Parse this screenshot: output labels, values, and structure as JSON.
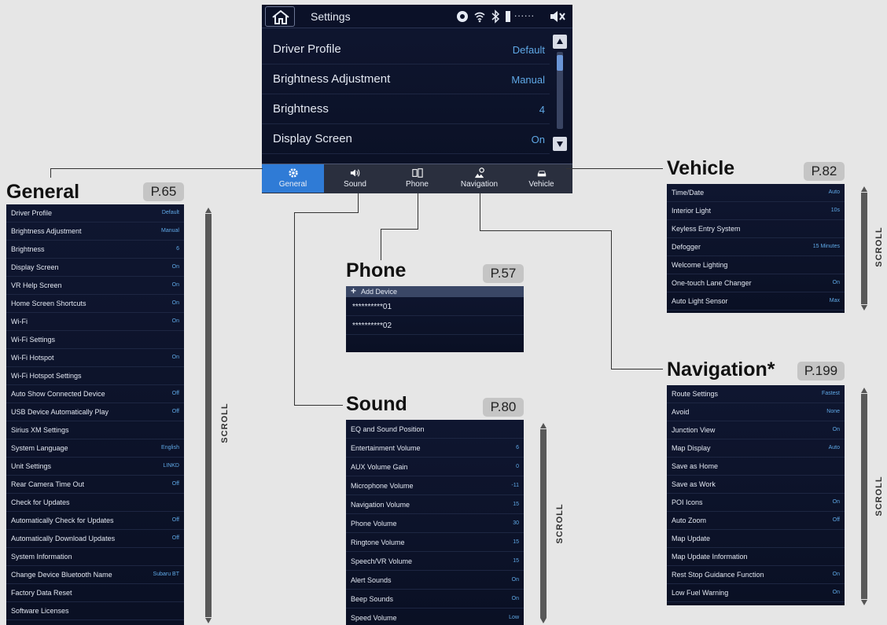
{
  "main_screen": {
    "title": "Settings",
    "battery": "......",
    "rows": [
      {
        "label": "Driver Profile",
        "value": "Default"
      },
      {
        "label": "Brightness Adjustment",
        "value": "Manual"
      },
      {
        "label": "Brightness",
        "value": "4"
      },
      {
        "label": "Display Screen",
        "value": "On"
      }
    ],
    "tabs": [
      {
        "label": "General",
        "icon": "gear-icon"
      },
      {
        "label": "Sound",
        "icon": "speaker-icon"
      },
      {
        "label": "Phone",
        "icon": "phone-icon"
      },
      {
        "label": "Navigation",
        "icon": "map-pin-icon"
      },
      {
        "label": "Vehicle",
        "icon": "car-icon"
      }
    ]
  },
  "general": {
    "title": "General",
    "page": "P.65",
    "scroll": "SCROLL",
    "rows": [
      {
        "label": "Driver Profile",
        "value": "Default"
      },
      {
        "label": "Brightness Adjustment",
        "value": "Manual"
      },
      {
        "label": "Brightness",
        "value": "6"
      },
      {
        "label": "Display Screen",
        "value": "On"
      },
      {
        "label": "VR Help Screen",
        "value": "On"
      },
      {
        "label": "Home Screen Shortcuts",
        "value": "On"
      },
      {
        "label": "Wi-Fi",
        "value": "On"
      },
      {
        "label": "Wi-Fi Settings",
        "value": ""
      },
      {
        "label": "Wi-Fi Hotspot",
        "value": "On"
      },
      {
        "label": "Wi-Fi Hotspot Settings",
        "value": ""
      },
      {
        "label": "Auto Show Connected Device",
        "value": "Off"
      },
      {
        "label": "USB Device Automatically Play",
        "value": "Off"
      },
      {
        "label": "Sirius XM Settings",
        "value": ""
      },
      {
        "label": "System Language",
        "value": "English"
      },
      {
        "label": "Unit Settings",
        "value": "LINKD"
      },
      {
        "label": "Rear Camera Time Out",
        "value": "Off"
      },
      {
        "label": "Check for Updates",
        "value": ""
      },
      {
        "label": "Automatically Check for Updates",
        "value": "Off"
      },
      {
        "label": "Automatically Download Updates",
        "value": "Off"
      },
      {
        "label": "System Information",
        "value": ""
      },
      {
        "label": "Change Device Bluetooth Name",
        "value": "Subaru BT"
      },
      {
        "label": "Factory Data Reset",
        "value": ""
      },
      {
        "label": "Software Licenses",
        "value": ""
      }
    ]
  },
  "phone": {
    "title": "Phone",
    "page": "P.57",
    "add_device": "Add Device",
    "rows": [
      {
        "label": "**********01"
      },
      {
        "label": "**********02"
      }
    ]
  },
  "sound": {
    "title": "Sound",
    "page": "P.80",
    "scroll": "SCROLL",
    "rows": [
      {
        "label": "EQ and Sound Position",
        "value": ""
      },
      {
        "label": "Entertainment Volume",
        "value": "6"
      },
      {
        "label": "AUX Volume Gain",
        "value": "0"
      },
      {
        "label": "Microphone Volume",
        "value": "-11"
      },
      {
        "label": "Navigation Volume",
        "value": "15"
      },
      {
        "label": "Phone Volume",
        "value": "30"
      },
      {
        "label": "Ringtone Volume",
        "value": "15"
      },
      {
        "label": "Speech/VR Volume",
        "value": "15"
      },
      {
        "label": "Alert Sounds",
        "value": "On"
      },
      {
        "label": "Beep Sounds",
        "value": "On"
      },
      {
        "label": "Speed Volume",
        "value": "Low"
      }
    ]
  },
  "vehicle": {
    "title": "Vehicle",
    "page": "P.82",
    "scroll": "SCROLL",
    "rows": [
      {
        "label": "Time/Date",
        "value": "Auto"
      },
      {
        "label": "Interior Light",
        "value": "10s"
      },
      {
        "label": "Keyless Entry System",
        "value": ""
      },
      {
        "label": "Defogger",
        "value": "15 Minutes"
      },
      {
        "label": "Welcome Lighting",
        "value": ""
      },
      {
        "label": "One-touch Lane Changer",
        "value": "On"
      },
      {
        "label": "Auto Light Sensor",
        "value": "Max"
      }
    ]
  },
  "navigation": {
    "title": "Navigation*",
    "page": "P.199",
    "scroll": "SCROLL",
    "rows": [
      {
        "label": "Route Settings",
        "value": "Fastest"
      },
      {
        "label": "Avoid",
        "value": "None"
      },
      {
        "label": "Junction View",
        "value": "On"
      },
      {
        "label": "Map Display",
        "value": "Auto"
      },
      {
        "label": "Save as Home",
        "value": ""
      },
      {
        "label": "Save as Work",
        "value": ""
      },
      {
        "label": "POI Icons",
        "value": "On"
      },
      {
        "label": "Auto Zoom",
        "value": "Off"
      },
      {
        "label": "Map Update",
        "value": ""
      },
      {
        "label": "Map Update Information",
        "value": ""
      },
      {
        "label": "Rest Stop Guidance Function",
        "value": "On"
      },
      {
        "label": "Low Fuel Warning",
        "value": "On"
      }
    ]
  }
}
